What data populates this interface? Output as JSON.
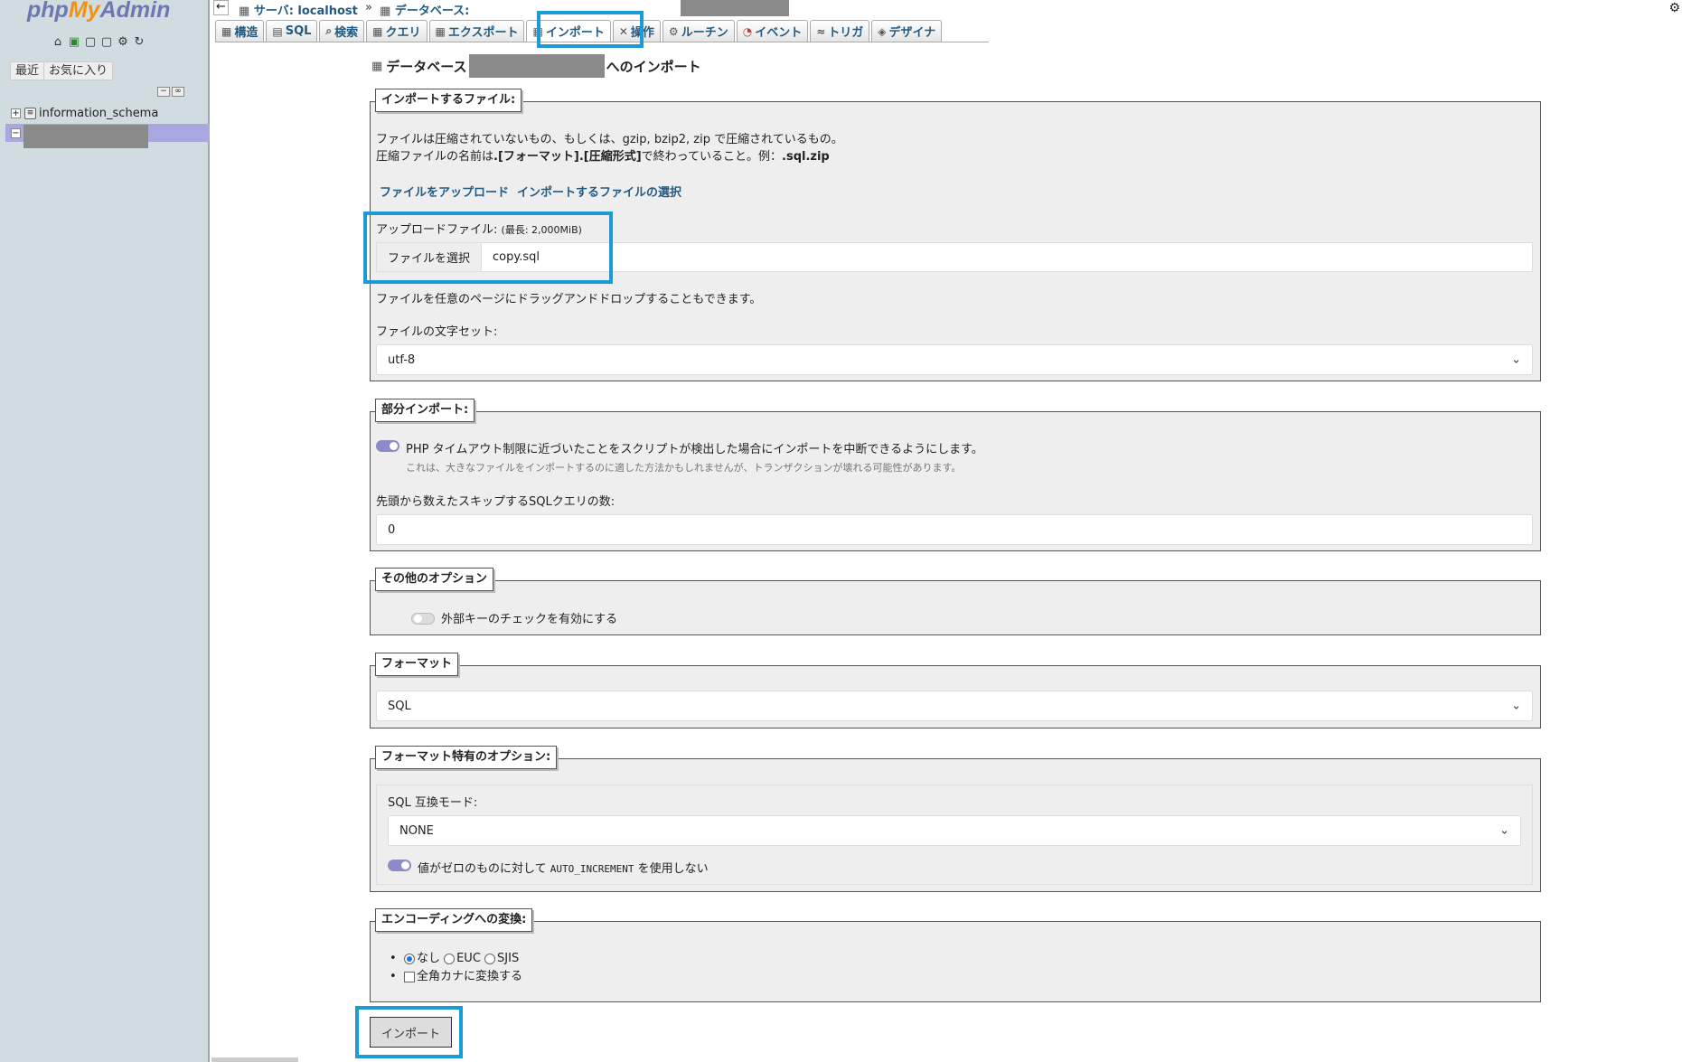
{
  "nav": {
    "logo_php": "php",
    "logo_my": "My",
    "logo_admin": "Admin",
    "recent_label": "最近",
    "favorites_label": "お気に入り",
    "tree": [
      {
        "label": "information_schema"
      },
      {
        "label": ""
      }
    ]
  },
  "breadcrumb": {
    "server": "サーバ: localhost",
    "separator": "»",
    "database": "データベース:"
  },
  "tabs": [
    {
      "label": "構造",
      "icon": "structure-icon"
    },
    {
      "label": "SQL",
      "icon": "sql-icon"
    },
    {
      "label": "検索",
      "icon": "search-icon"
    },
    {
      "label": "クエリ",
      "icon": "query-icon"
    },
    {
      "label": "エクスポート",
      "icon": "export-icon"
    },
    {
      "label": "インポート",
      "icon": "import-icon",
      "active": true
    },
    {
      "label": "操作",
      "icon": "operations-icon"
    },
    {
      "label": "ルーチン",
      "icon": "routines-icon"
    },
    {
      "label": "イベント",
      "icon": "events-icon"
    },
    {
      "label": "トリガ",
      "icon": "triggers-icon"
    },
    {
      "label": "デザイナ",
      "icon": "designer-icon"
    }
  ],
  "page": {
    "title_prefix": "データベース",
    "title_suffix": "へのインポート"
  },
  "file_section": {
    "legend": "インポートするファイル:",
    "line1": "ファイルは圧縮されていないもの、もしくは、gzip, bzip2, zip で圧縮されているもの。",
    "line2_a": "圧縮ファイルの名前は",
    "line2_b": ".[フォーマット].[圧縮形式]",
    "line2_c": "で終わっていること。例：",
    "line2_d": ".sql.zip",
    "link_upload": "ファイルをアップロード",
    "link_select": "インポートするファイルの選択",
    "upload_label": "アップロードファイル:",
    "upload_max": "(最長: 2,000MiB)",
    "choose_file_button": "ファイルを選択",
    "file_name": "copy.sql",
    "drag_drop_hint": "ファイルを任意のページにドラッグアンドドロップすることもできます。",
    "charset_label": "ファイルの文字セット:",
    "charset_value": "utf-8"
  },
  "partial_section": {
    "legend": "部分インポート:",
    "toggle_label": "PHP タイムアウト制限に近づいたことをスクリプトが検出した場合にインポートを中断できるようにします。",
    "toggle_on": true,
    "toggle_hint": "これは、大きなファイルをインポートするのに適した方法かもしれませんが、トランザクションが壊れる可能性があります。",
    "skip_label": "先頭から数えたスキップするSQLクエリの数:",
    "skip_value": "0"
  },
  "other_section": {
    "legend": "その他のオプション",
    "fk_label": "外部キーのチェックを有効にする",
    "fk_on": false
  },
  "format_section": {
    "legend": "フォーマット",
    "value": "SQL"
  },
  "format_options": {
    "legend": "フォーマット特有のオプション:",
    "compat_label": "SQL 互換モード:",
    "compat_value": "NONE",
    "auto_inc_prefix": "値がゼロのものに対して",
    "auto_inc_code": "AUTO_INCREMENT",
    "auto_inc_suffix": "を使用しない",
    "auto_inc_on": true
  },
  "encoding_section": {
    "legend": "エンコーディングへの変換:",
    "options": [
      "なし",
      "EUC",
      "SJIS"
    ],
    "selected": "なし",
    "kana_label": "全角カナに変換する"
  },
  "import_button": "インポート",
  "colors": {
    "highlight": "#1a9ad6",
    "link": "#235a81",
    "nav_bg": "#d0dce0",
    "toggle_on": "#8e8ac9"
  }
}
